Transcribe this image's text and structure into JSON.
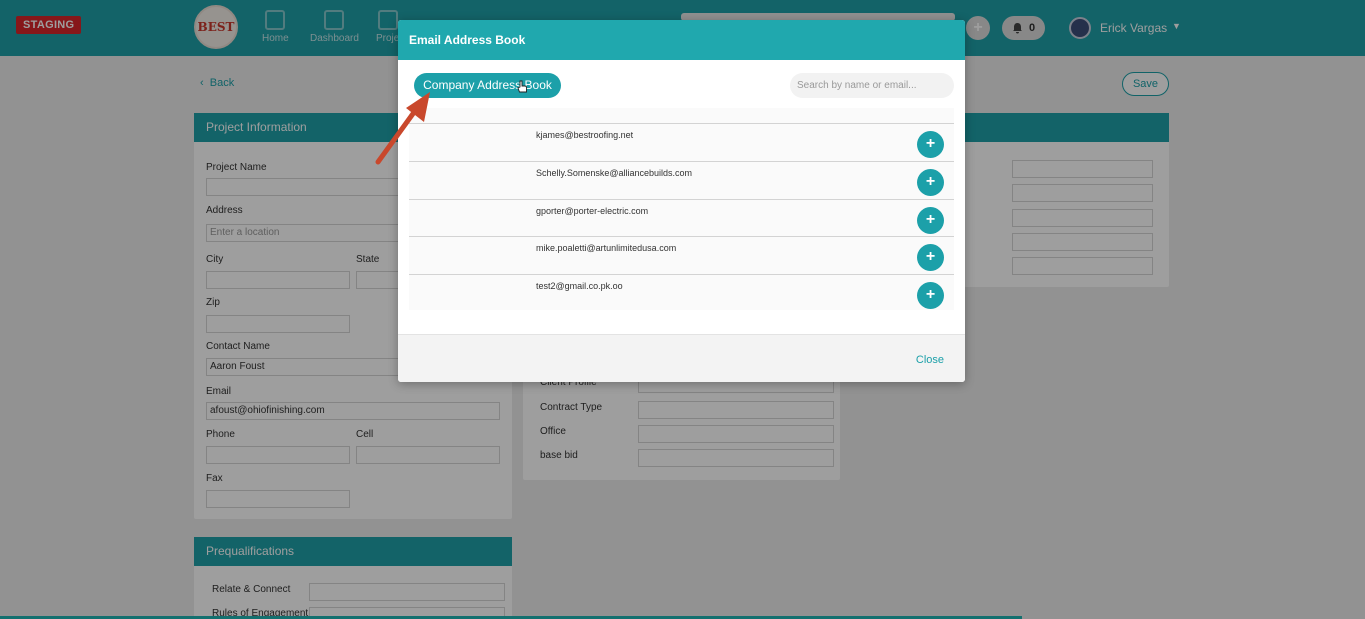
{
  "topbar": {
    "env_badge": "STAGING",
    "logo_text": "BEST",
    "nav": [
      {
        "label": "Home",
        "icon": "chart-icon"
      },
      {
        "label": "Dashboard",
        "icon": "dashboard-icon"
      },
      {
        "label": "Proje",
        "icon": "folder-icon"
      }
    ],
    "notification_count": "0",
    "user_name": "Erick Vargas"
  },
  "page": {
    "back_label": "Back",
    "save_label": "Save",
    "project_info": {
      "title": "Project Information",
      "project_name_label": "Project Name",
      "address_label": "Address",
      "address_placeholder": "Enter a location",
      "city_label": "City",
      "state_label": "State",
      "zip_label": "Zip",
      "contact_name_label": "Contact Name",
      "contact_name_value": "Aaron Foust",
      "email_label": "Email",
      "email_value": "afoust@ohiofinishing.com",
      "phone_label": "Phone",
      "cell_label": "Cell",
      "fax_label": "Fax"
    },
    "middle_card": {
      "client_profile_label": "Client Profile",
      "contract_type_label": "Contract Type",
      "office_label": "Office",
      "base_bid_label": "base bid"
    },
    "prequalifications": {
      "title": "Prequalifications",
      "relate_connect_label": "Relate & Connect",
      "rules_label": "Rules of Engagement"
    }
  },
  "modal": {
    "title": "Email Address Book",
    "tab_label": "Company Address Book",
    "search_placeholder": "Search by name or email...",
    "contacts": [
      {
        "email": "kjames@bestroofing.net"
      },
      {
        "email": "Schelly.Somenske@alliancebuilds.com"
      },
      {
        "email": "gporter@porter-electric.com"
      },
      {
        "email": "mike.poaletti@artunlimitedusa.com"
      },
      {
        "email": "test2@gmail.co.pk.oo"
      }
    ],
    "add_symbol": "+",
    "close_label": "Close"
  },
  "colors": {
    "brand_teal": "#20a0a8",
    "staging_red": "#d8262b",
    "annotation_arrow": "#c9482c"
  }
}
